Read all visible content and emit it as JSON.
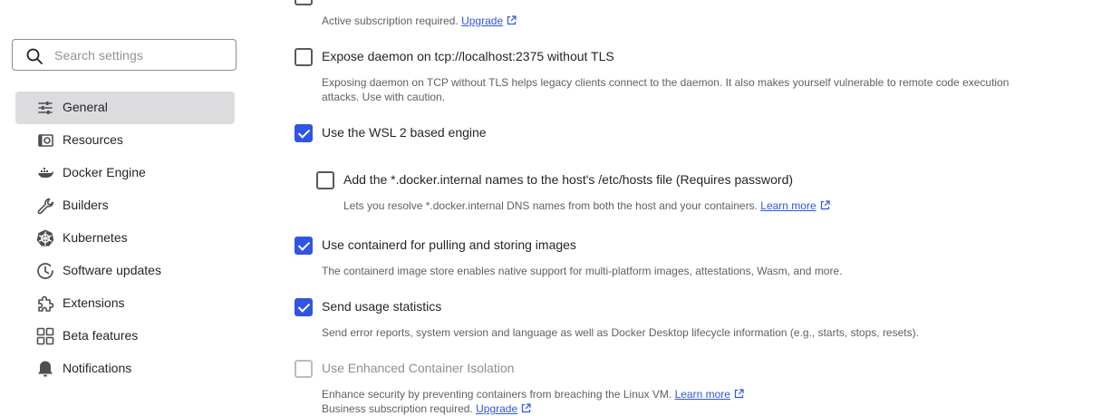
{
  "search": {
    "placeholder": "Search settings"
  },
  "sidebar": {
    "items": [
      {
        "label": "General",
        "icon": "sliders-icon",
        "active": true
      },
      {
        "label": "Resources",
        "icon": "resources-icon"
      },
      {
        "label": "Docker Engine",
        "icon": "whale-icon"
      },
      {
        "label": "Builders",
        "icon": "wrench-icon"
      },
      {
        "label": "Kubernetes",
        "icon": "helm-icon"
      },
      {
        "label": "Software updates",
        "icon": "clock-icon"
      },
      {
        "label": "Extensions",
        "icon": "puzzle-icon"
      },
      {
        "label": "Beta features",
        "icon": "grid-icon"
      },
      {
        "label": "Notifications",
        "icon": "bell-icon"
      }
    ]
  },
  "settings": {
    "top_note": {
      "text": "Active subscription required.",
      "link": "Upgrade"
    },
    "expose_daemon": {
      "label": "Expose daemon on tcp://localhost:2375 without TLS",
      "checked": false,
      "desc_line1": "Exposing daemon on TCP without TLS helps legacy clients connect to the daemon. It also makes yourself vulnerable to remote code execution",
      "desc_line2": "attacks. Use with caution."
    },
    "wsl2": {
      "label": "Use the WSL 2 based engine",
      "checked": true
    },
    "hosts_file": {
      "label": "Add the *.docker.internal names to the host's /etc/hosts file (Requires password)",
      "checked": false,
      "desc": "Lets you resolve *.docker.internal DNS names from both the host and your containers.",
      "link": "Learn more"
    },
    "containerd": {
      "label": "Use containerd for pulling and storing images",
      "checked": true,
      "desc": "The containerd image store enables native support for multi-platform images, attestations, Wasm, and more."
    },
    "usage_stats": {
      "label": "Send usage statistics",
      "checked": true,
      "desc": "Send error reports, system version and language as well as Docker Desktop lifecycle information (e.g., starts, stops, resets)."
    },
    "eci": {
      "label": "Use Enhanced Container Isolation",
      "checked": false,
      "disabled": true,
      "desc": "Enhance security by preventing containers from breaching the Linux VM.",
      "link": "Learn more",
      "note": "Business subscription required.",
      "note_link": "Upgrade"
    }
  },
  "colors": {
    "accent": "#2f55e4",
    "active_bg": "#dcdcde",
    "text": "#1f2328",
    "muted": "#5d6167"
  }
}
